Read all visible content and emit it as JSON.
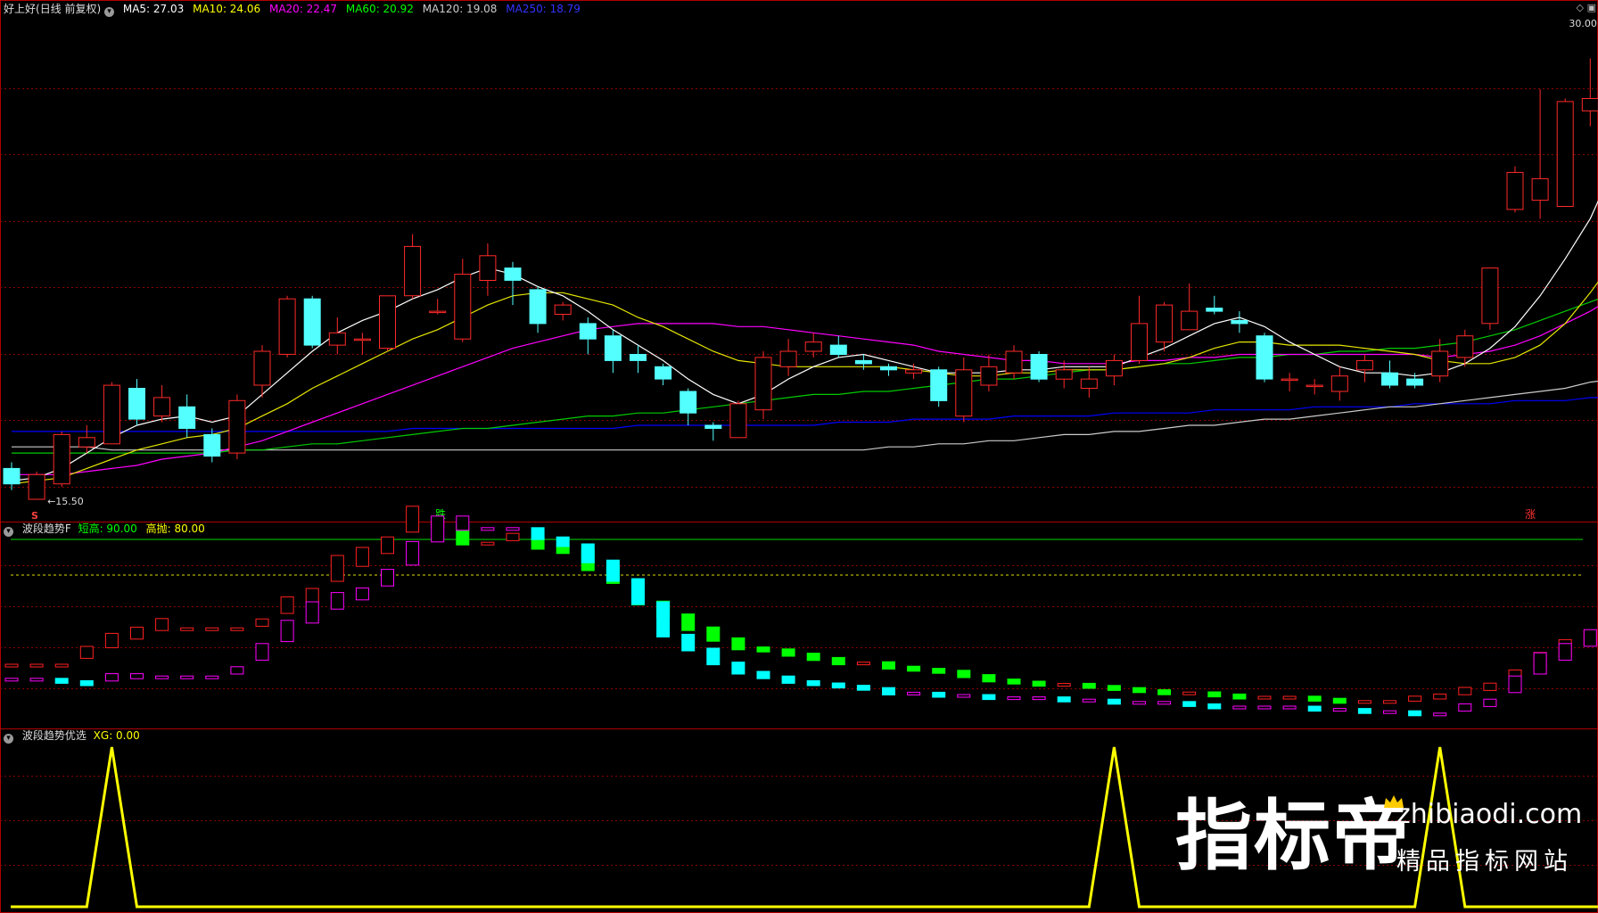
{
  "stock": {
    "name": "好上好",
    "period": "(日线 前复权)"
  },
  "ma_legend": [
    {
      "label": "MA5: 27.03",
      "color": "#ffffff"
    },
    {
      "label": "MA10: 24.06",
      "color": "#ffff00"
    },
    {
      "label": "MA20: 22.47",
      "color": "#ff00ff"
    },
    {
      "label": "MA60: 20.92",
      "color": "#00ff00"
    },
    {
      "label": "MA120: 19.08",
      "color": "#cccccc"
    },
    {
      "label": "MA250: 18.79",
      "color": "#0000ff"
    }
  ],
  "price_axis": {
    "min": 15.5,
    "max": 31.0
  },
  "annotations": {
    "high_label": "30.00",
    "low_label": "15.50",
    "signal_down": "跌",
    "signal_up": "涨",
    "marker_s": "S"
  },
  "indicator1": {
    "name": "波段趋势F",
    "line1": "短高: 90.00",
    "line2": "高抛: 80.00",
    "line1_color": "#00ff00",
    "line2_color": "#ffff00",
    "y_range": [
      0,
      100
    ]
  },
  "indicator2": {
    "name": "波段趋势优选",
    "xg": "XG: 0.00",
    "color": "#ffff00"
  },
  "watermark": {
    "cn": "指标帝",
    "en": "zhibiaodi.com",
    "sub": "精品指标网站"
  },
  "chart_data": [
    {
      "type": "candlestick",
      "title": "好上好 (日线 前复权)",
      "candles": [
        [
          16.5,
          16.0,
          16.7,
          15.8
        ],
        [
          15.5,
          16.3,
          16.4,
          15.5
        ],
        [
          16.0,
          17.6,
          17.7,
          15.9
        ],
        [
          17.2,
          17.5,
          17.9,
          17.0
        ],
        [
          17.3,
          19.2,
          19.3,
          17.3
        ],
        [
          19.1,
          18.1,
          19.4,
          17.9
        ],
        [
          18.2,
          18.8,
          19.2,
          18.0
        ],
        [
          18.5,
          17.8,
          18.9,
          17.5
        ],
        [
          17.6,
          16.9,
          17.8,
          16.7
        ],
        [
          17.0,
          18.7,
          18.9,
          16.8
        ],
        [
          19.2,
          20.3,
          20.5,
          18.8
        ],
        [
          20.2,
          22.0,
          22.1,
          20.1
        ],
        [
          22.0,
          20.5,
          22.1,
          20.4
        ],
        [
          20.5,
          20.9,
          21.4,
          20.2
        ],
        [
          20.7,
          20.7,
          20.9,
          20.2
        ],
        [
          20.4,
          22.1,
          22.1,
          20.3
        ],
        [
          22.1,
          23.7,
          24.1,
          22.0
        ],
        [
          21.6,
          21.6,
          22.0,
          21.5
        ],
        [
          20.7,
          22.8,
          23.3,
          20.6
        ],
        [
          22.6,
          23.4,
          23.8,
          22.1
        ],
        [
          23.0,
          22.6,
          23.2,
          21.8
        ],
        [
          22.3,
          21.2,
          22.4,
          20.9
        ],
        [
          21.5,
          21.8,
          21.9,
          21.3
        ],
        [
          21.2,
          20.7,
          21.4,
          20.2
        ],
        [
          20.8,
          20.0,
          21.0,
          19.6
        ],
        [
          20.2,
          20.0,
          20.5,
          19.6
        ],
        [
          19.8,
          19.4,
          19.9,
          19.2
        ],
        [
          19.0,
          18.3,
          19.1,
          17.9
        ],
        [
          17.9,
          17.8,
          18.0,
          17.4
        ],
        [
          17.5,
          18.6,
          18.7,
          17.5
        ],
        [
          18.4,
          20.1,
          20.3,
          18.1
        ],
        [
          19.8,
          20.3,
          20.7,
          19.5
        ],
        [
          20.3,
          20.6,
          20.9,
          20.1
        ],
        [
          20.5,
          20.2,
          20.8,
          20.1
        ],
        [
          20.0,
          19.9,
          20.2,
          19.7
        ],
        [
          19.8,
          19.7,
          19.9,
          19.5
        ],
        [
          19.6,
          19.7,
          19.9,
          19.4
        ],
        [
          19.7,
          18.7,
          19.8,
          18.5
        ],
        [
          18.2,
          19.7,
          20.1,
          18.0
        ],
        [
          19.2,
          19.8,
          20.2,
          19.0
        ],
        [
          19.6,
          20.3,
          20.5,
          19.4
        ],
        [
          20.2,
          19.4,
          20.3,
          19.3
        ],
        [
          19.4,
          19.7,
          20.0,
          19.1
        ],
        [
          19.1,
          19.4,
          19.8,
          18.8
        ],
        [
          19.5,
          20.0,
          20.2,
          19.2
        ],
        [
          20.0,
          21.2,
          22.1,
          19.9
        ],
        [
          20.6,
          21.8,
          21.9,
          20.3
        ],
        [
          21.0,
          21.6,
          22.5,
          21.0
        ],
        [
          21.7,
          21.6,
          22.1,
          21.5
        ],
        [
          21.3,
          21.2,
          21.6,
          20.9
        ],
        [
          20.8,
          19.4,
          20.9,
          19.3
        ],
        [
          19.4,
          19.4,
          19.6,
          19.0
        ],
        [
          19.2,
          19.2,
          19.4,
          18.9
        ],
        [
          19.0,
          19.5,
          19.8,
          18.7
        ],
        [
          19.7,
          20.0,
          20.2,
          19.3
        ],
        [
          19.6,
          19.2,
          20.0,
          19.1
        ],
        [
          19.4,
          19.2,
          19.6,
          19.1
        ],
        [
          19.5,
          20.3,
          20.7,
          19.3
        ],
        [
          20.1,
          20.8,
          21.0,
          19.8
        ],
        [
          21.2,
          23.0,
          23.0,
          21.0
        ],
        [
          24.9,
          26.1,
          26.3,
          24.8
        ],
        [
          25.2,
          25.9,
          28.8,
          24.6
        ],
        [
          25.0,
          28.4,
          28.5,
          25.0
        ],
        [
          28.1,
          28.5,
          29.8,
          27.6
        ],
        [
          26.9,
          29.4,
          31.0,
          26.9
        ]
      ],
      "ma_lines": {
        "MA5": [
          16.1,
          16.2,
          16.5,
          17.0,
          17.5,
          17.9,
          18.1,
          18.2,
          18.0,
          18.2,
          18.9,
          19.6,
          20.3,
          20.9,
          21.3,
          21.6,
          22.0,
          22.3,
          22.7,
          23.0,
          22.8,
          22.4,
          22.1,
          21.6,
          21.0,
          20.5,
          20.0,
          19.4,
          18.9,
          18.6,
          18.9,
          19.4,
          19.8,
          20.1,
          20.2,
          20.0,
          19.8,
          19.6,
          19.6,
          19.6,
          19.7,
          19.7,
          19.8,
          19.8,
          19.8,
          20.1,
          20.4,
          20.8,
          21.2,
          21.4,
          21.1,
          20.6,
          20.2,
          19.8,
          19.6,
          19.6,
          19.5,
          19.6,
          19.9,
          20.4,
          21.1,
          22.1,
          23.3,
          24.6,
          26.4
        ],
        "MA10": [
          16.0,
          16.1,
          16.2,
          16.5,
          16.8,
          17.1,
          17.3,
          17.5,
          17.6,
          17.8,
          18.2,
          18.6,
          19.1,
          19.5,
          19.9,
          20.3,
          20.7,
          21.0,
          21.4,
          21.8,
          22.1,
          22.2,
          22.2,
          22.0,
          21.8,
          21.4,
          21.1,
          20.7,
          20.3,
          20.0,
          19.9,
          19.8,
          19.8,
          19.8,
          19.8,
          19.8,
          19.7,
          19.6,
          19.5,
          19.5,
          19.6,
          19.6,
          19.7,
          19.7,
          19.7,
          19.8,
          19.9,
          20.1,
          20.4,
          20.6,
          20.6,
          20.5,
          20.5,
          20.5,
          20.4,
          20.3,
          20.2,
          20.0,
          19.9,
          19.9,
          20.1,
          20.5,
          21.2,
          22.2,
          23.3
        ],
        "MA20": [
          16.3,
          16.3,
          16.3,
          16.4,
          16.5,
          16.6,
          16.8,
          16.9,
          17.0,
          17.2,
          17.4,
          17.7,
          18.0,
          18.3,
          18.6,
          18.9,
          19.2,
          19.5,
          19.8,
          20.1,
          20.4,
          20.6,
          20.8,
          21.0,
          21.1,
          21.2,
          21.2,
          21.2,
          21.2,
          21.1,
          21.1,
          21.0,
          20.9,
          20.8,
          20.7,
          20.6,
          20.5,
          20.3,
          20.2,
          20.1,
          20.0,
          20.0,
          19.9,
          19.9,
          19.9,
          20.0,
          20.0,
          20.1,
          20.1,
          20.2,
          20.2,
          20.2,
          20.2,
          20.2,
          20.2,
          20.2,
          20.2,
          20.1,
          20.2,
          20.3,
          20.5,
          20.8,
          21.2,
          21.6,
          22.1
        ],
        "MA60": [
          17.0,
          17.0,
          17.0,
          17.0,
          17.0,
          17.0,
          17.0,
          17.0,
          17.0,
          17.1,
          17.1,
          17.2,
          17.3,
          17.3,
          17.4,
          17.5,
          17.6,
          17.7,
          17.8,
          17.8,
          17.9,
          18.0,
          18.1,
          18.2,
          18.2,
          18.3,
          18.3,
          18.4,
          18.5,
          18.6,
          18.7,
          18.8,
          18.9,
          18.9,
          19.0,
          19.0,
          19.1,
          19.2,
          19.3,
          19.4,
          19.4,
          19.5,
          19.6,
          19.7,
          19.7,
          19.8,
          19.9,
          19.9,
          20.0,
          20.1,
          20.1,
          20.2,
          20.2,
          20.3,
          20.3,
          20.4,
          20.4,
          20.5,
          20.6,
          20.8,
          21.0,
          21.3,
          21.6,
          21.9,
          22.2
        ],
        "MA120": [
          17.2,
          17.2,
          17.2,
          17.2,
          17.1,
          17.1,
          17.1,
          17.1,
          17.1,
          17.1,
          17.1,
          17.1,
          17.1,
          17.1,
          17.1,
          17.1,
          17.1,
          17.1,
          17.1,
          17.1,
          17.1,
          17.1,
          17.1,
          17.1,
          17.1,
          17.1,
          17.1,
          17.1,
          17.1,
          17.1,
          17.1,
          17.1,
          17.1,
          17.1,
          17.1,
          17.2,
          17.2,
          17.3,
          17.3,
          17.4,
          17.4,
          17.5,
          17.6,
          17.6,
          17.7,
          17.7,
          17.8,
          17.9,
          17.9,
          18.0,
          18.1,
          18.1,
          18.2,
          18.3,
          18.4,
          18.5,
          18.5,
          18.6,
          18.7,
          18.8,
          18.9,
          19.0,
          19.1,
          19.3,
          19.4
        ],
        "MA250": [
          17.7,
          17.7,
          17.7,
          17.7,
          17.7,
          17.7,
          17.7,
          17.7,
          17.7,
          17.7,
          17.7,
          17.7,
          17.7,
          17.7,
          17.7,
          17.7,
          17.8,
          17.8,
          17.8,
          17.8,
          17.8,
          17.8,
          17.8,
          17.8,
          17.8,
          17.9,
          17.9,
          17.9,
          17.9,
          17.9,
          17.9,
          17.9,
          17.9,
          18.0,
          18.0,
          18.0,
          18.1,
          18.1,
          18.1,
          18.1,
          18.2,
          18.2,
          18.2,
          18.2,
          18.3,
          18.3,
          18.3,
          18.3,
          18.4,
          18.4,
          18.4,
          18.4,
          18.5,
          18.5,
          18.5,
          18.5,
          18.6,
          18.6,
          18.6,
          18.6,
          18.7,
          18.7,
          18.7,
          18.8,
          18.8
        ]
      }
    },
    {
      "type": "bar",
      "title": "波段趋势F",
      "ylim": [
        0,
        100
      ],
      "hlines": [
        90,
        80
      ],
      "upper": [
        5,
        5,
        5,
        9,
        14,
        18,
        22,
        22,
        22,
        22,
        24,
        30,
        35,
        45,
        52,
        58,
        68,
        70,
        62,
        62,
        64,
        60,
        58,
        50,
        44,
        34,
        28,
        22,
        17,
        13,
        12,
        10,
        8,
        6,
        6,
        4,
        3,
        2,
        0,
        -2,
        -3,
        -4,
        -4,
        -5,
        -6,
        -7,
        -8,
        -8,
        -9,
        -10,
        -10,
        -10,
        -11,
        -12,
        -12,
        -12,
        -11,
        -10,
        -8,
        -6,
        -2,
        4,
        10,
        15,
        20
      ],
      "lower": [
        5,
        5,
        4,
        3,
        5,
        6,
        6,
        6,
        6,
        8,
        14,
        22,
        30,
        36,
        40,
        46,
        55,
        65,
        70,
        70,
        70,
        66,
        63,
        56,
        48,
        38,
        24,
        18,
        12,
        8,
        6,
        4,
        3,
        2,
        1,
        -1,
        -1,
        -2,
        -2,
        -3,
        -3,
        -3,
        -4,
        -4,
        -5,
        -5,
        -5,
        -6,
        -7,
        -7,
        -7,
        -7,
        -8,
        -8,
        -9,
        -9,
        -10,
        -10,
        -8,
        -6,
        0,
        8,
        14,
        20,
        24
      ]
    },
    {
      "type": "line",
      "title": "波段趋势优选",
      "ylim": [
        0,
        1
      ],
      "values": [
        0,
        0,
        0,
        0,
        1,
        0,
        0,
        0,
        0,
        0,
        0,
        0,
        0,
        0,
        0,
        0,
        0,
        0,
        0,
        0,
        0,
        0,
        0,
        0,
        0,
        0,
        0,
        0,
        0,
        0,
        0,
        0,
        0,
        0,
        0,
        0,
        0,
        0,
        0,
        0,
        0,
        0,
        0,
        0,
        1,
        0,
        0,
        0,
        0,
        0,
        0,
        0,
        0,
        0,
        0,
        0,
        0,
        1,
        0,
        0,
        0,
        0,
        0,
        0,
        0
      ]
    }
  ]
}
